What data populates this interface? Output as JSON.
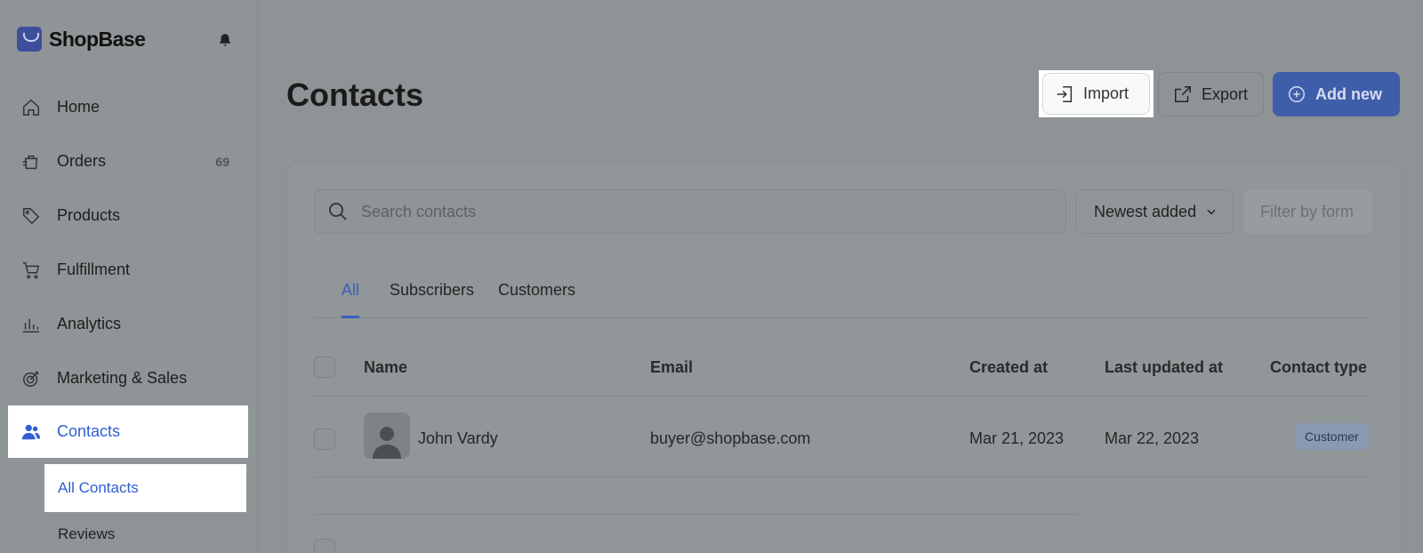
{
  "brand": {
    "name": "ShopBase"
  },
  "sidebar": {
    "items": [
      {
        "label": "Home",
        "icon": "home-icon"
      },
      {
        "label": "Orders",
        "icon": "orders-icon",
        "badge": "69"
      },
      {
        "label": "Products",
        "icon": "tag-icon"
      },
      {
        "label": "Fulfillment",
        "icon": "cart-icon"
      },
      {
        "label": "Analytics",
        "icon": "bar-chart-icon"
      },
      {
        "label": "Marketing & Sales",
        "icon": "target-icon"
      },
      {
        "label": "Contacts",
        "icon": "users-icon",
        "active": true
      }
    ],
    "sub_items": [
      {
        "label": "All Contacts",
        "active": true
      },
      {
        "label": "Reviews"
      }
    ]
  },
  "header": {
    "title": "Contacts",
    "import_label": "Import",
    "export_label": "Export",
    "add_label": "Add new"
  },
  "toolbar": {
    "search_placeholder": "Search contacts",
    "sort_label": "Newest added",
    "filter_label": "Filter by form"
  },
  "tabs": [
    "All",
    "Subscribers",
    "Customers"
  ],
  "table": {
    "columns": [
      "Name",
      "Email",
      "Created at",
      "Last updated at",
      "Contact type"
    ],
    "rows": [
      {
        "name": "John Vardy",
        "email": "buyer@shopbase.com",
        "created": "Mar 21, 2023",
        "updated": "Mar 22, 2023",
        "type": "Customer"
      }
    ]
  },
  "colors": {
    "accent": "#2f5fd0",
    "overlay": "#8e9395",
    "primary_button": "#3f5ea9"
  }
}
